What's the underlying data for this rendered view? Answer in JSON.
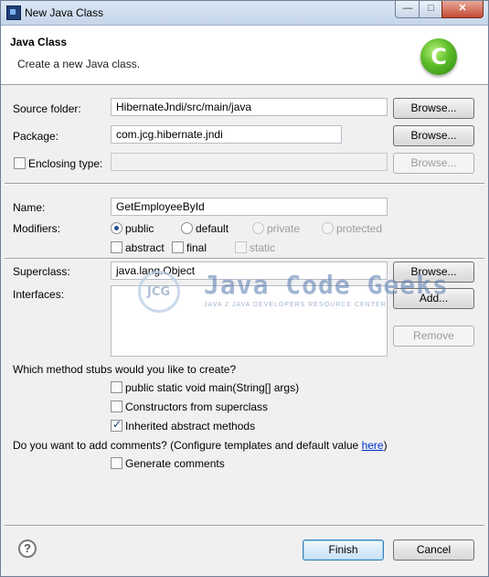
{
  "window": {
    "title": "New Java Class",
    "minimize_glyph": "—",
    "maximize_glyph": "□",
    "close_glyph": "✕"
  },
  "header": {
    "title": "Java Class",
    "subtitle": "Create a new Java class.",
    "icon": "java-class-wizard-icon",
    "icon_letter": "C"
  },
  "source_folder": {
    "label": "Source folder:",
    "value": "HibernateJndi/src/main/java",
    "browse_label": "Browse..."
  },
  "package": {
    "label": "Package:",
    "value": "com.jcg.hibernate.jndi",
    "browse_label": "Browse..."
  },
  "enclosing_type": {
    "label": "Enclosing type:",
    "checked": false,
    "value": "",
    "browse_label": "Browse..."
  },
  "name": {
    "label": "Name:",
    "value": "GetEmployeeById"
  },
  "modifiers": {
    "label": "Modifiers:",
    "access": [
      {
        "label": "public",
        "selected": true,
        "enabled": true
      },
      {
        "label": "default",
        "selected": false,
        "enabled": true
      },
      {
        "label": "private",
        "selected": false,
        "enabled": false
      },
      {
        "label": "protected",
        "selected": false,
        "enabled": false
      }
    ],
    "flags": [
      {
        "label": "abstract",
        "checked": false,
        "enabled": true
      },
      {
        "label": "final",
        "checked": false,
        "enabled": true
      },
      {
        "label": "static",
        "checked": false,
        "enabled": false
      }
    ]
  },
  "superclass": {
    "label": "Superclass:",
    "value": "java.lang.Object",
    "browse_label": "Browse..."
  },
  "interfaces": {
    "label": "Interfaces:",
    "add_label": "Add...",
    "remove_label": "Remove"
  },
  "watermark": {
    "logo_text": "JCG",
    "name": "Java Code Geeks",
    "tagline": "JAVA 2 JAVA DEVELOPERS RESOURCE CENTER"
  },
  "stubs": {
    "question": "Which method stubs would you like to create?",
    "options": [
      {
        "label": "public static void main(String[] args)",
        "checked": false
      },
      {
        "label": "Constructors from superclass",
        "checked": false
      },
      {
        "label": "Inherited abstract methods",
        "checked": true
      }
    ]
  },
  "comments": {
    "question": "Do you want to add comments? (Configure templates and default value ",
    "link": "here",
    "close_paren": ")",
    "generate_label": "Generate comments",
    "checked": false
  },
  "footer": {
    "help_glyph": "?",
    "finish_label": "Finish",
    "cancel_label": "Cancel"
  }
}
